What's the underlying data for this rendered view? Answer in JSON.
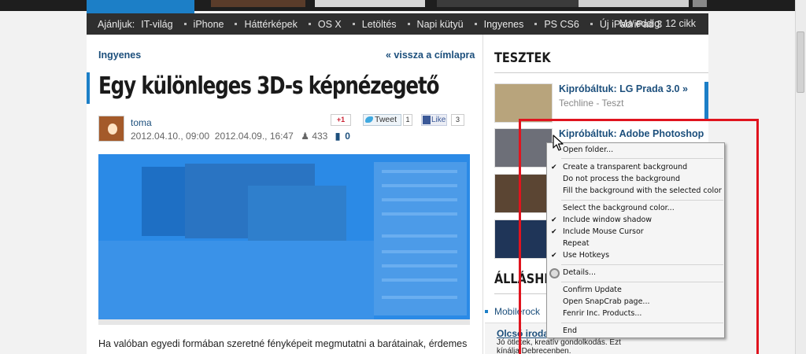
{
  "header": {
    "recommend_label": "Ajánljuk:",
    "recommend_items": [
      "IT-világ",
      "iPhone",
      "Háttérképek",
      "OS X",
      "Letöltés",
      "Napi kütyü",
      "Ingyenes",
      "PS CS6",
      "Új iPad/iPad 3"
    ],
    "today_count": "Ma eddig: 12 cikk"
  },
  "article": {
    "category": "Ingyenes",
    "back_link": "« vissza a címlapra",
    "title": "Egy különleges 3D-s képnézegető",
    "author": "toma",
    "date_published": "2012.04.10., 09:00",
    "date_updated": "2012.04.09., 16:47",
    "views": "433",
    "comments": "0",
    "gplus_label": "+1",
    "tweet_label": "Tweet",
    "tweet_count": "1",
    "like_label": "Like",
    "like_count": "3",
    "paragraph": "Ha valóban egyedi formában szeretné fényképeit megmutatni a barátainak, érdemes"
  },
  "sidebar": {
    "heading": "TESZTEK",
    "items": [
      {
        "title": "Kipróbáltuk: LG Prada 3.0 »",
        "subtitle": "Techline - Teszt"
      },
      {
        "title": "Kipróbáltuk: Adobe Photoshop",
        "subtitle": ""
      }
    ],
    "jobs_heading": "ÁLLÁSHIR",
    "jobs_link": "Mobilerock",
    "ad_title": "Olcsó iroda",
    "ad_line1": "Jó ötletek, kreatív gondolkodás. Ezt",
    "ad_line2": "kínálja Debrecenben."
  },
  "context_menu": {
    "items": [
      {
        "label": "Open folder...",
        "checked": false
      },
      {
        "label": "Create a transparent background",
        "checked": true
      },
      {
        "label": "Do not process the background",
        "checked": false
      },
      {
        "label": "Fill the background with the selected color",
        "checked": false
      },
      {
        "label": "Select the background color...",
        "checked": false
      },
      {
        "label": "Include window shadow",
        "checked": true
      },
      {
        "label": "Include Mouse Cursor",
        "checked": true
      },
      {
        "label": "Repeat",
        "checked": false
      },
      {
        "label": "Use Hotkeys",
        "checked": true
      },
      {
        "label": "Details...",
        "checked": false
      },
      {
        "label": "Confirm Update",
        "checked": false
      },
      {
        "label": "Open SnapCrab page...",
        "checked": false
      },
      {
        "label": "Fenrir Inc. Products...",
        "checked": false
      },
      {
        "label": "End",
        "checked": false
      }
    ],
    "check_glyph": "✔"
  },
  "colors": {
    "accent": "#1c7fc7",
    "capture_frame": "#e0141e",
    "selection": "#2b8ae6"
  }
}
